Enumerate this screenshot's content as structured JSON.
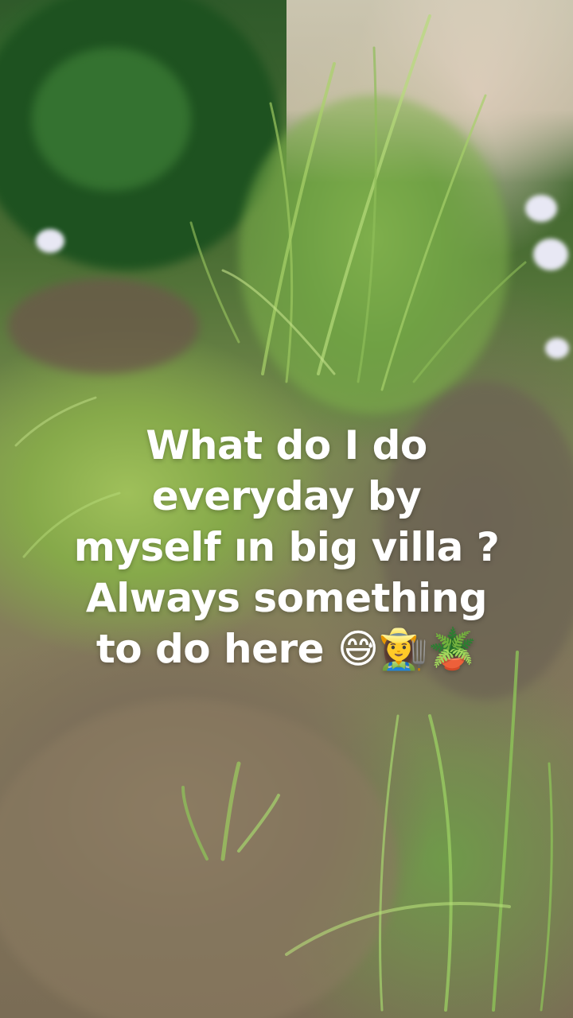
{
  "caption": {
    "lines": [
      "What do I do",
      "everyday by",
      "myself ın big villa ?",
      "Always something",
      "to do here"
    ],
    "emojis": [
      "😅",
      "👩‍🌾",
      "🪴"
    ]
  },
  "photo": {
    "subject": "garden-grass-plants"
  }
}
